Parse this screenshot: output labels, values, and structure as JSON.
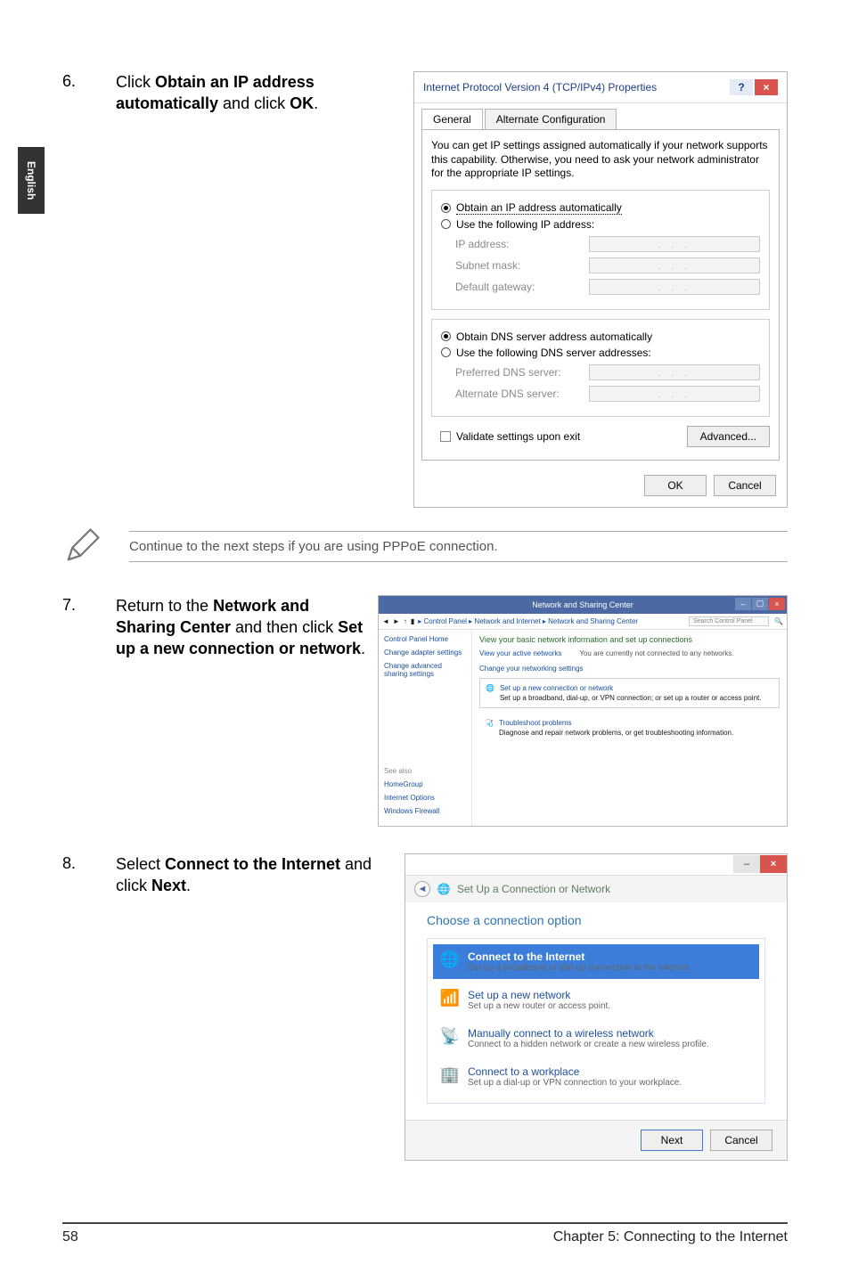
{
  "sidebar": {
    "lang": "English"
  },
  "steps": {
    "s6": {
      "num": "6.",
      "pre": "Click ",
      "b1": "Obtain an IP address automatically",
      "mid": " and click ",
      "b2": "OK",
      "post": "."
    },
    "s7": {
      "num": "7.",
      "pre": "Return to the ",
      "b1": "Network and Sharing Center",
      "mid": " and then click ",
      "b2": "Set up a new connection or network",
      "post": "."
    },
    "s8": {
      "num": "8.",
      "pre": "Select ",
      "b1": "Connect to the Internet",
      "mid": " and click ",
      "b2": "Next",
      "post": "."
    }
  },
  "note": {
    "text": "Continue to the next steps if you are using PPPoE connection."
  },
  "dlg1": {
    "title": "Internet Protocol Version 4 (TCP/IPv4) Properties",
    "tabs": {
      "general": "General",
      "alt": "Alternate Configuration"
    },
    "descr": "You can get IP settings assigned automatically if your network supports this capability. Otherwise, you need to ask your network administrator for the appropriate IP settings.",
    "r_auto_ip": "Obtain an IP address automatically",
    "r_use_ip": "Use the following IP address:",
    "f_ip": "IP address:",
    "f_subnet": "Subnet mask:",
    "f_gateway": "Default gateway:",
    "r_auto_dns": "Obtain DNS server address automatically",
    "r_use_dns": "Use the following DNS server addresses:",
    "f_pref": "Preferred DNS server:",
    "f_alt": "Alternate DNS server:",
    "validate": "Validate settings upon exit",
    "advanced": "Advanced...",
    "ok": "OK",
    "cancel": "Cancel",
    "dots": ".   .   ."
  },
  "dlg2": {
    "title": "Network and Sharing Center",
    "crumb": "▸ Control Panel ▸ Network and Internet ▸ Network and Sharing Center",
    "search_ph": "Search Control Panel",
    "side": {
      "home": "Control Panel Home",
      "adapter": "Change adapter settings",
      "sharing": "Change advanced sharing settings",
      "seealso": "See also",
      "hg": "HomeGroup",
      "io": "Internet Options",
      "wf": "Windows Firewall"
    },
    "content": {
      "h": "View your basic network information and set up connections",
      "l1a": "View your active networks",
      "l1b": "You are currently not connected to any networks.",
      "l2": "Change your networking settings",
      "b1t": "Set up a new connection or network",
      "b1s": "Set up a broadband, dial-up, or VPN connection; or set up a router or access point.",
      "b2t": "Troubleshoot problems",
      "b2s": "Diagnose and repair network problems, or get troubleshooting information."
    }
  },
  "dlg3": {
    "crumb": "Set Up a Connection or Network",
    "h": "Choose a connection option",
    "opts": {
      "o1t": "Connect to the Internet",
      "o1s": "Set up a broadband or dial-up connection to the Internet.",
      "o2t": "Set up a new network",
      "o2s": "Set up a new router or access point.",
      "o3t": "Manually connect to a wireless network",
      "o3s": "Connect to a hidden network or create a new wireless profile.",
      "o4t": "Connect to a workplace",
      "o4s": "Set up a dial-up or VPN connection to your workplace."
    },
    "next": "Next",
    "cancel": "Cancel"
  },
  "footer": {
    "page": "58",
    "chapter": "Chapter 5: Connecting to the Internet"
  }
}
